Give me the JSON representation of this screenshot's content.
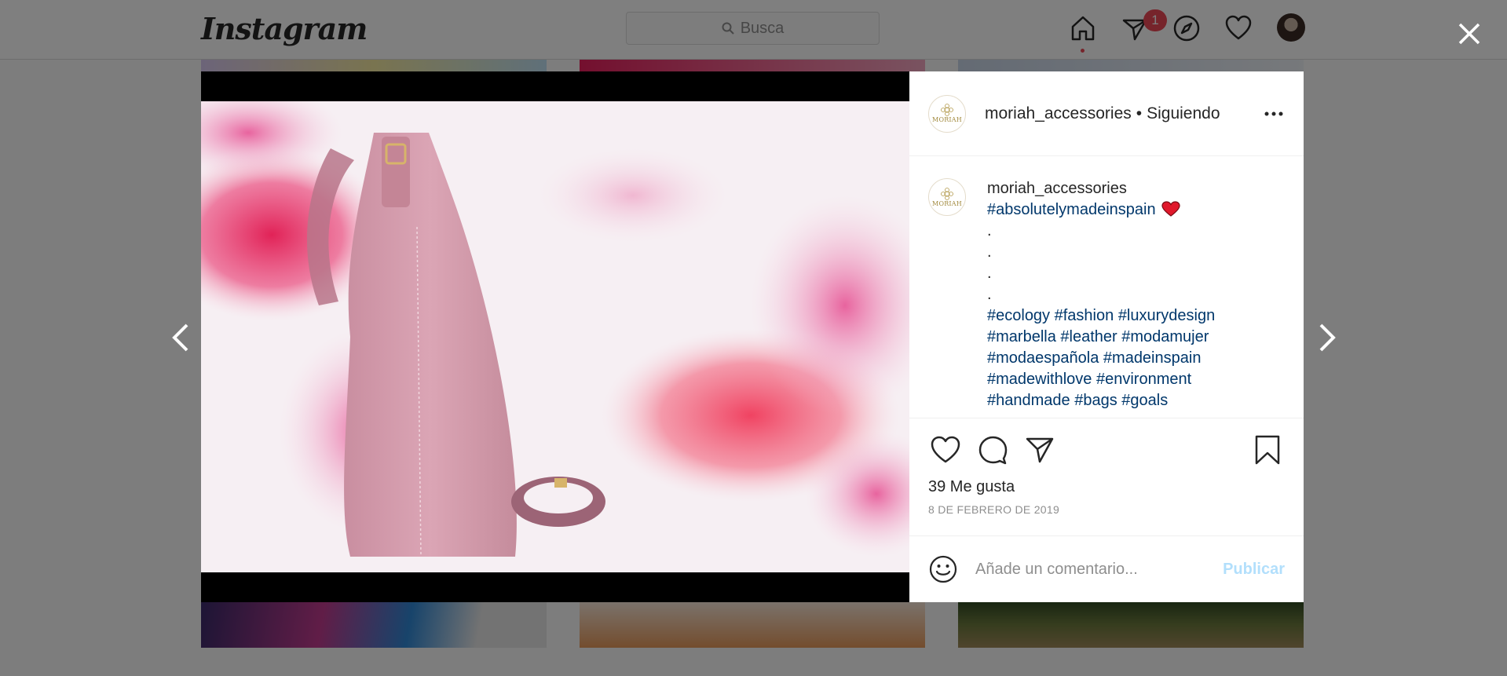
{
  "topbar": {
    "logo": "Instagram",
    "search_placeholder": "Busca",
    "notification_count": "1"
  },
  "post": {
    "username": "moriah_accessories",
    "separator": "•",
    "follow_status": "Siguiendo",
    "avatar_wordmark": "MORIAH",
    "caption": {
      "username": "moriah_accessories",
      "first_hashtag": "#absolutelymadeinspain",
      "emoji": "❤️",
      "dots": [
        ".",
        ".",
        ".",
        "."
      ],
      "hashtags": [
        "#ecology",
        "#fashion",
        "#luxurydesign",
        "#marbella",
        "#leather",
        "#modamujer",
        "#modaespañola",
        "#madeinspain",
        "#madewithlove",
        "#environment",
        "#handmade",
        "#bags",
        "#goals"
      ]
    },
    "likes": "39 Me gusta",
    "date": "8 DE FEBRERO DE 2019",
    "comment_placeholder": "Añade un comentario...",
    "publish_label": "Publicar"
  },
  "icons": {
    "search": "search-icon",
    "home": "home-icon",
    "direct": "direct-icon",
    "explore": "compass-icon",
    "activity": "heart-icon",
    "close": "close-icon",
    "prev": "chevron-left-icon",
    "next": "chevron-right-icon",
    "more": "more-icon",
    "like": "heart-icon",
    "comment": "comment-icon",
    "share": "share-icon",
    "save": "bookmark-icon",
    "emoji": "emoji-icon"
  },
  "colors": {
    "link": "#00376b",
    "notification": "#ed4956",
    "publish_disabled": "#b2dffc"
  }
}
